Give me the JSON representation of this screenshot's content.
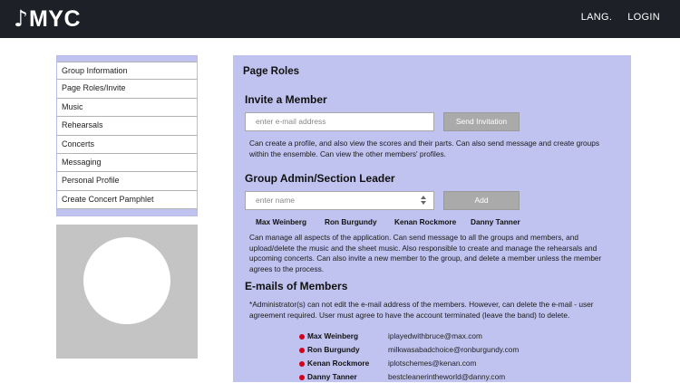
{
  "header": {
    "logo_note": "♪",
    "logo_text": "MYC",
    "nav": [
      "LANG.",
      "LOGIN"
    ]
  },
  "sidebar": {
    "items": [
      "Group Information",
      "Page Roles/Invite",
      "Music",
      "Rehearsals",
      "Concerts",
      "Messaging",
      "Personal Profile",
      "Create Concert Pamphlet"
    ]
  },
  "main": {
    "title": "Page Roles",
    "invite": {
      "heading": "Invite a Member",
      "placeholder": "enter e-mail address",
      "button": "Send Invitation",
      "description": "Can create a profile, and also view the scores and their parts.  Can also send message and create groups within the ensemble.   Can view the other members' profiles."
    },
    "admin": {
      "heading": "Group Admin/Section Leader",
      "placeholder": "enter name",
      "button": "Add",
      "names": [
        "Max Weinberg",
        "Ron Burgundy",
        "Kenan Rockmore",
        "Danny Tanner"
      ],
      "description": "Can manage all aspects of the application.  Can send message to all the groups and members, and upload/delete the music and the sheet music.  Also responsible to create and manage the rehearsals and upcoming concerts.   Can also invite a new member to the group, and delete a member unless the member agrees to the process."
    },
    "emails": {
      "heading": "E-mails of Members",
      "note": "*Administrator(s) can not edit the e-mail address of the members.  However, can delete the e-mail - user agreement required.   User must agree to have the account terminated (leave the band) to delete.",
      "members": [
        {
          "name": "Max Weinberg",
          "email": "iplayedwithbruce@max.com"
        },
        {
          "name": "Ron Burgundy",
          "email": "milkwasabadchoice@ronburgundy.com"
        },
        {
          "name": "Kenan Rockmore",
          "email": "iplotschemes@kenan.com"
        },
        {
          "name": "Danny Tanner",
          "email": "bestcleanerintheworld@danny.com"
        }
      ]
    }
  },
  "colors": {
    "topbar": "#1d2027",
    "panel": "#c0c3ef",
    "bullet": "#d0021b",
    "button": "#aaaaaa"
  }
}
